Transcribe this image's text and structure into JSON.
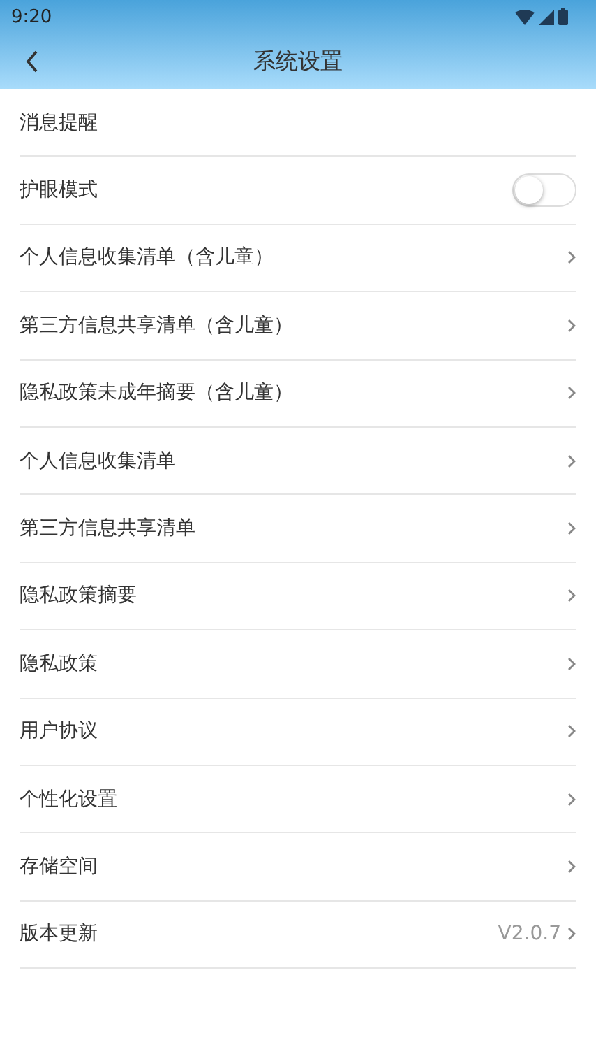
{
  "status_bar": {
    "time": "9:20"
  },
  "header": {
    "title": "系统设置"
  },
  "items": [
    {
      "kind": "plain",
      "label": "消息提醒"
    },
    {
      "kind": "toggle",
      "label": "护眼模式",
      "on": false
    },
    {
      "kind": "link",
      "label": "个人信息收集清单（含儿童）"
    },
    {
      "kind": "link",
      "label": "第三方信息共享清单（含儿童）"
    },
    {
      "kind": "link",
      "label": "隐私政策未成年摘要（含儿童）"
    },
    {
      "kind": "link",
      "label": "个人信息收集清单"
    },
    {
      "kind": "link",
      "label": "第三方信息共享清单"
    },
    {
      "kind": "link",
      "label": "隐私政策摘要"
    },
    {
      "kind": "link",
      "label": "隐私政策"
    },
    {
      "kind": "link",
      "label": "用户协议"
    },
    {
      "kind": "link",
      "label": "个性化设置"
    },
    {
      "kind": "link",
      "label": "存储空间"
    },
    {
      "kind": "link",
      "label": "版本更新",
      "value": "V2.0.7"
    }
  ]
}
